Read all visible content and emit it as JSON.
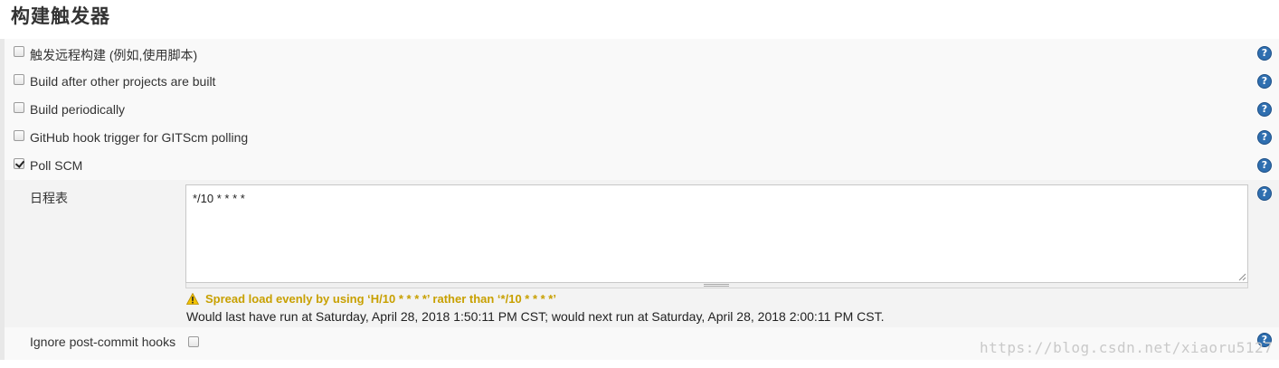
{
  "section": {
    "title": "构建触发器"
  },
  "triggers": [
    {
      "label": "触发远程构建 (例如,使用脚本)",
      "checked": false
    },
    {
      "label": "Build after other projects are built",
      "checked": false
    },
    {
      "label": "Build periodically",
      "checked": false
    },
    {
      "label": "GitHub hook trigger for GITScm polling",
      "checked": false
    },
    {
      "label": "Poll SCM",
      "checked": true
    }
  ],
  "help": {
    "glyph": "?"
  },
  "schedule": {
    "label": "日程表",
    "value": "*/10 * * * *",
    "warning": "Spread load evenly by using ‘H/10 * * * *’ rather than ‘*/10 * * * *’",
    "info": "Would last have run at Saturday, April 28, 2018 1:50:11 PM CST; would next run at Saturday, April 28, 2018 2:00:11 PM CST."
  },
  "ignore_hooks": {
    "label": "Ignore post-commit hooks",
    "checked": false
  },
  "watermark": "https://blog.csdn.net/xiaoru5127",
  "colors": {
    "warning": "#c8a000",
    "help": "#2f6fb0"
  }
}
